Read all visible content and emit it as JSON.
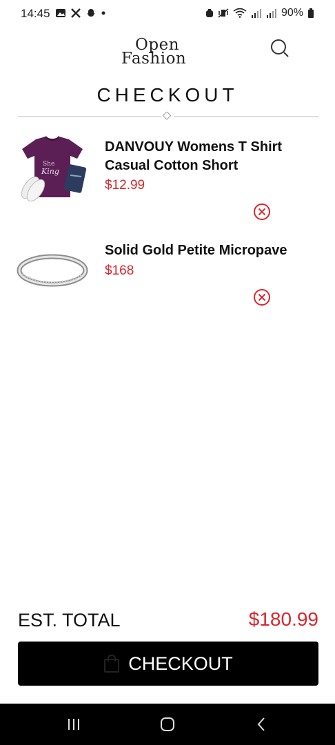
{
  "status_bar": {
    "time": "14:45",
    "battery": "90%"
  },
  "header": {
    "logo_line1": "Open",
    "logo_line2": "Fashion"
  },
  "page": {
    "title": "CHECKOUT"
  },
  "cart": {
    "items": [
      {
        "name": "DANVOUY Womens T Shirt Casual Cotton Short",
        "price": "$12.99",
        "thumb_icon": "purple-tshirt-image"
      },
      {
        "name": "Solid Gold Petite Micropave",
        "price": "$168",
        "thumb_icon": "silver-ring-image"
      }
    ]
  },
  "summary": {
    "total_label": "EST. TOTAL",
    "total_value": "$180.99"
  },
  "checkout_button": {
    "label": "CHECKOUT"
  },
  "colors": {
    "accent_red": "#d9262c",
    "button_bg": "#000000"
  }
}
